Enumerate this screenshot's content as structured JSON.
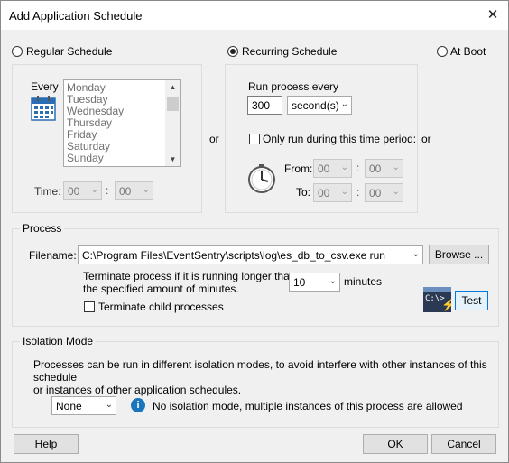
{
  "dialog": {
    "title": "Add Application Schedule"
  },
  "schedule": {
    "regular_label": "Regular Schedule",
    "recurring_label": "Recurring Schedule",
    "atboot_label": "At Boot",
    "selected": "recurring",
    "or_label": "or",
    "every_label": "Every",
    "days": [
      "Monday",
      "Tuesday",
      "Wednesday",
      "Thursday",
      "Friday",
      "Saturday",
      "Sunday"
    ],
    "time_label": "Time:",
    "time_hour": "00",
    "time_minute": "00",
    "time_sep": ":",
    "run_every_label": "Run process every",
    "run_every_value": "300",
    "run_every_unit": "second(s)",
    "only_period_label": "Only run during this time period:",
    "from_label": "From:",
    "to_label": "To:",
    "from_hour": "00",
    "from_minute": "00",
    "to_hour": "00",
    "to_minute": "00"
  },
  "process": {
    "legend": "Process",
    "filename_label": "Filename:",
    "filename_value": "C:\\Program Files\\EventSentry\\scripts\\log\\es_db_to_csv.exe run",
    "browse_label": "Browse ...",
    "terminate_text_1": "Terminate process if it is running longer than",
    "terminate_text_2": "the specified amount of minutes.",
    "minutes_value": "10",
    "minutes_label": "minutes",
    "terminate_children_label": "Terminate child processes",
    "test_label": "Test",
    "console_icon_text": "C:\\>"
  },
  "isolation": {
    "legend": "Isolation Mode",
    "desc_1": "Processes can be run in different isolation modes, to avoid interfere with other instances of this schedule",
    "desc_2": "or instances of other application schedules.",
    "mode_value": "None",
    "info_text": "No isolation mode, multiple instances of this process are allowed"
  },
  "buttons": {
    "help": "Help",
    "ok": "OK",
    "cancel": "Cancel"
  }
}
